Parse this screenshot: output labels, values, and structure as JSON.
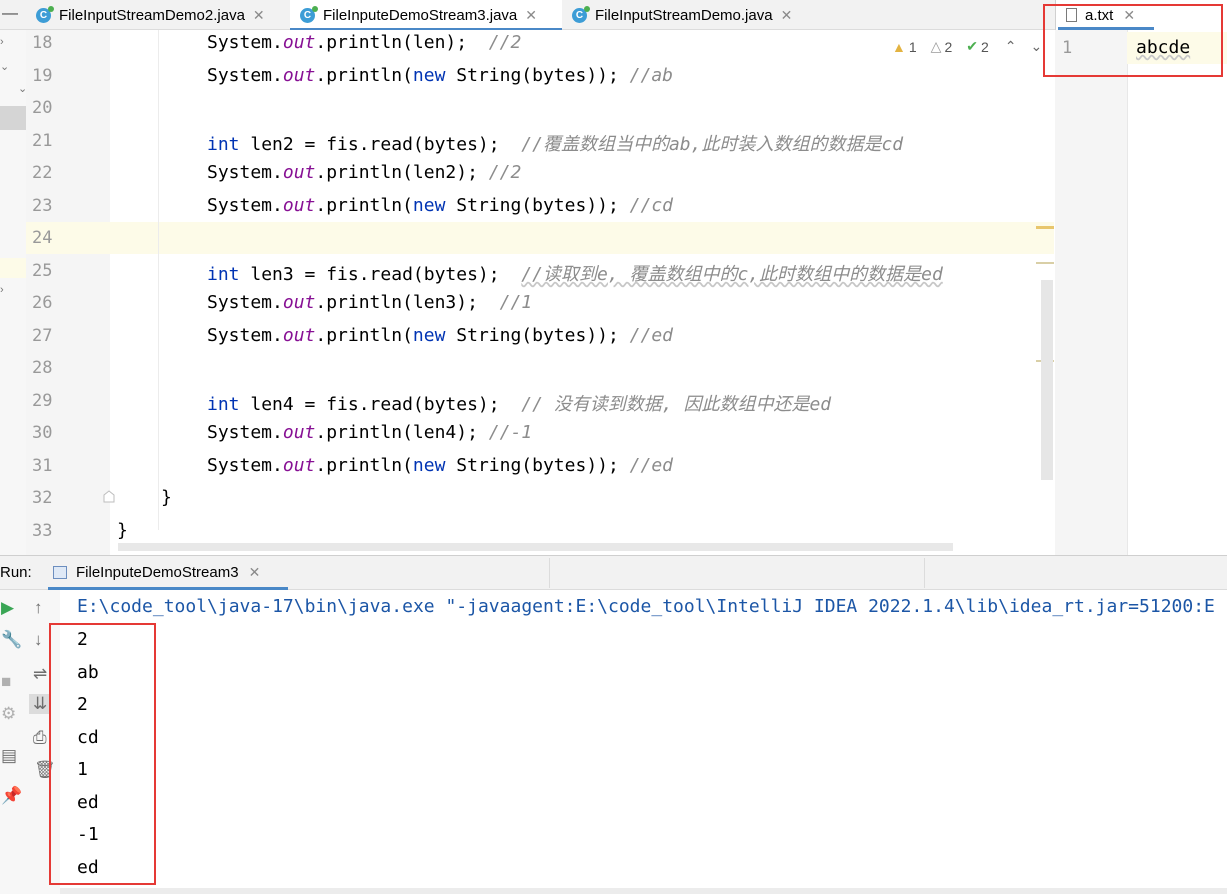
{
  "editor_tabs": [
    {
      "label": "FileInputStreamDemo2.java",
      "icon": "java-class-icon",
      "active": false
    },
    {
      "label": "FileInputeDemoStream3.java",
      "icon": "java-class-icon",
      "active": true
    },
    {
      "label": "FileInputStreamDemo.java",
      "icon": "java-class-icon",
      "active": false
    }
  ],
  "inspections": {
    "warnings": "1",
    "weak_warnings": "2",
    "typos": "2"
  },
  "line_numbers": [
    "18",
    "19",
    "20",
    "21",
    "22",
    "23",
    "24",
    "25",
    "26",
    "27",
    "28",
    "29",
    "30",
    "31",
    "32",
    "33"
  ],
  "code": {
    "l18": {
      "a": "System.",
      "f": "out",
      "b": ".println(len);  ",
      "c": "//2"
    },
    "l19": {
      "a": "System.",
      "f": "out",
      "b": ".println(",
      "k": "new",
      "d": " String(bytes)); ",
      "c": "//ab"
    },
    "l21": {
      "k": "int",
      "a": " len2 = fis.read(bytes);  ",
      "c": "//覆盖数组当中的ab,此时装入数组的数据是cd"
    },
    "l22": {
      "a": "System.",
      "f": "out",
      "b": ".println(len2); ",
      "c": "//2"
    },
    "l23": {
      "a": "System.",
      "f": "out",
      "b": ".println(",
      "k": "new",
      "d": " String(bytes)); ",
      "c": "//cd"
    },
    "l25": {
      "k": "int",
      "a": " len3 = fis.read(bytes);  ",
      "c": "//读取到e, 覆盖数组中的c,此时数组中的数据是ed"
    },
    "l26": {
      "a": "System.",
      "f": "out",
      "b": ".println(len3);  ",
      "c": "//1"
    },
    "l27": {
      "a": "System.",
      "f": "out",
      "b": ".println(",
      "k": "new",
      "d": " String(bytes)); ",
      "c": "//ed"
    },
    "l29": {
      "k": "int",
      "a": " len4 = fis.read(bytes);  ",
      "c": "// 没有读到数据, 因此数组中还是ed"
    },
    "l30": {
      "a": "System.",
      "f": "out",
      "b": ".println(len4); ",
      "c": "//-1"
    },
    "l31": {
      "a": "System.",
      "f": "out",
      "b": ".println(",
      "k": "new",
      "d": " String(bytes)); ",
      "c": "//ed"
    },
    "l32": "}",
    "l33": "}"
  },
  "text_file": {
    "tab_label": "a.txt",
    "line_number": "1",
    "content": "abcde"
  },
  "run": {
    "label": "Run:",
    "tab_label": "FileInputeDemoStream3",
    "command": "E:\\code_tool\\java-17\\bin\\java.exe \"-javaagent:E:\\code_tool\\IntelliJ IDEA 2022.1.4\\lib\\idea_rt.jar=51200:E",
    "output": [
      "2",
      "ab",
      "2",
      "cd",
      "1",
      "ed",
      "-1",
      "ed"
    ]
  },
  "colors": {
    "keyword": "#0033b3",
    "field": "#871094",
    "comment": "#8c8c8c",
    "highlight_box": "#e53935",
    "active_tab": "#4a88c7"
  }
}
